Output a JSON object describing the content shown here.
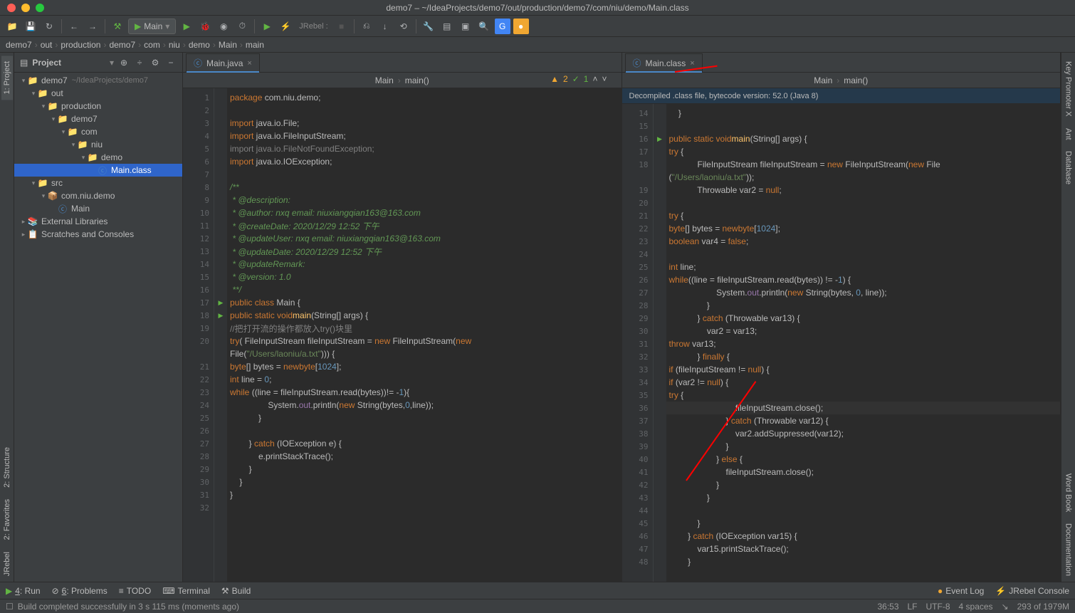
{
  "title": "demo7 – ~/IdeaProjects/demo7/out/production/demo7/com/niu/demo/Main.class",
  "runConfig": "Main",
  "jrebel": "JRebel :",
  "breadcrumb": [
    "demo7",
    "out",
    "production",
    "demo7",
    "com",
    "niu",
    "demo",
    "Main",
    "main"
  ],
  "sidebar": {
    "title": "Project",
    "tree": [
      {
        "l": 0,
        "arrow": "▾",
        "icon": "folder-blue",
        "text": "demo7",
        "path": "~/IdeaProjects/demo7"
      },
      {
        "l": 1,
        "arrow": "▾",
        "icon": "folder",
        "text": "out"
      },
      {
        "l": 2,
        "arrow": "▾",
        "icon": "folder",
        "text": "production"
      },
      {
        "l": 3,
        "arrow": "▾",
        "icon": "folder",
        "text": "demo7"
      },
      {
        "l": 4,
        "arrow": "▾",
        "icon": "folder",
        "text": "com"
      },
      {
        "l": 5,
        "arrow": "▾",
        "icon": "folder",
        "text": "niu"
      },
      {
        "l": 6,
        "arrow": "▾",
        "icon": "folder",
        "text": "demo"
      },
      {
        "l": 7,
        "arrow": "",
        "icon": "class",
        "text": "Main.class",
        "sel": true
      },
      {
        "l": 1,
        "arrow": "▾",
        "icon": "folder-blue",
        "text": "src"
      },
      {
        "l": 2,
        "arrow": "▾",
        "icon": "pkg",
        "text": "com.niu.demo"
      },
      {
        "l": 3,
        "arrow": "",
        "icon": "class",
        "text": "Main"
      },
      {
        "l": 0,
        "arrow": "▸",
        "icon": "lib",
        "text": "External Libraries"
      },
      {
        "l": 0,
        "arrow": "▸",
        "icon": "scratch",
        "text": "Scratches and Consoles"
      }
    ]
  },
  "leftEditor": {
    "tab": "Main.java",
    "bc": [
      "Main",
      "main()"
    ],
    "warn": {
      "y": "2",
      "g": "1"
    },
    "lines": [
      {
        "n": 1,
        "html": "<span class='kw'>package</span> com.niu.demo;"
      },
      {
        "n": 2,
        "html": ""
      },
      {
        "n": 3,
        "html": "<span class='kw'>import</span> java.io.File;"
      },
      {
        "n": 4,
        "html": "<span class='kw'>import</span> java.io.FileInputStream;"
      },
      {
        "n": 5,
        "html": "<span class='cm'>import java.io.FileNotFoundException;</span>"
      },
      {
        "n": 6,
        "html": "<span class='kw'>import</span> java.io.IOException;"
      },
      {
        "n": 7,
        "html": ""
      },
      {
        "n": 8,
        "html": "<span class='cmd'>/**</span>"
      },
      {
        "n": 9,
        "html": "<span class='cmd'> * @description:</span>"
      },
      {
        "n": 10,
        "html": "<span class='cmd'> * @author: nxq email: niuxiangqian163@163.com</span>"
      },
      {
        "n": 11,
        "html": "<span class='cmd'> * @createDate: 2020/12/29 12:52 下午</span>"
      },
      {
        "n": 12,
        "html": "<span class='cmd'> * @updateUser: nxq email: niuxiangqian163@163.com</span>"
      },
      {
        "n": 13,
        "html": "<span class='cmd'> * @updateDate: 2020/12/29 12:52 下午</span>"
      },
      {
        "n": 14,
        "html": "<span class='cmd'> * @updateRemark:</span>"
      },
      {
        "n": 15,
        "html": "<span class='cmd'> * @version: 1.0</span>"
      },
      {
        "n": 16,
        "html": "<span class='cmd'> **/</span>"
      },
      {
        "n": 17,
        "html": "<span class='kw'>public class</span> Main {",
        "mark": "run"
      },
      {
        "n": 18,
        "html": "    <span class='kw'>public static void</span> <span class='fn'>main</span>(String[] args) {",
        "mark": "run"
      },
      {
        "n": 19,
        "html": "        <span class='cm'>//把打开流的操作都放入try()块里</span>"
      },
      {
        "n": 20,
        "html": "        <span class='kw'>try</span>( FileInputStream fileInputStream = <span class='kw'>new</span> FileInputStream(<span class='kw'>new</span> "
      },
      {
        "n": "",
        "html": "File(<span class='str'>\"/Users/laoniu/a.txt\"</span>))) {"
      },
      {
        "n": 21,
        "html": "            <span class='kw'>byte</span>[] bytes = <span class='kw'>new</span> <span class='kw'>byte</span>[<span class='num'>1024</span>];"
      },
      {
        "n": 22,
        "html": "            <span class='kw'>int</span> line = <span class='num'>0</span>;"
      },
      {
        "n": 23,
        "html": "            <span class='kw'>while</span> ((line = fileInputStream.read(bytes))!= -<span class='num'>1</span>){"
      },
      {
        "n": 24,
        "html": "                System.<span style='color:#9876aa'>out</span>.println(<span class='kw'>new</span> String(bytes,<span class='num'>0</span>,line));"
      },
      {
        "n": 25,
        "html": "            }"
      },
      {
        "n": 26,
        "html": ""
      },
      {
        "n": 27,
        "html": "        } <span class='kw'>catch</span> (IOException e) {"
      },
      {
        "n": 28,
        "html": "            e.printStackTrace();"
      },
      {
        "n": 29,
        "html": "        }"
      },
      {
        "n": 30,
        "html": "    }"
      },
      {
        "n": 31,
        "html": "}"
      },
      {
        "n": 32,
        "html": ""
      }
    ]
  },
  "rightEditor": {
    "tab": "Main.class",
    "bc": [
      "Main",
      "main()"
    ],
    "info": "Decompiled .class file, bytecode version: 52.0 (Java 8)",
    "lines": [
      {
        "n": 14,
        "html": "    }"
      },
      {
        "n": 15,
        "html": ""
      },
      {
        "n": 16,
        "html": "    <span class='kw'>public static void</span> <span class='fn'>main</span>(String[] args) {",
        "mark": "run"
      },
      {
        "n": 17,
        "html": "        <span class='kw'>try</span> {"
      },
      {
        "n": 18,
        "html": "            FileInputStream fileInputStream = <span class='kw'>new</span> FileInputStream(<span class='kw'>new</span> File"
      },
      {
        "n": "",
        "html": "(<span class='str'>\"/Users/laoniu/a.txt\"</span>));"
      },
      {
        "n": 19,
        "html": "            Throwable var2 = <span class='kw'>null</span>;"
      },
      {
        "n": 20,
        "html": ""
      },
      {
        "n": 21,
        "html": "            <span class='kw'>try</span> {"
      },
      {
        "n": 22,
        "html": "                <span class='kw'>byte</span>[] bytes = <span class='kw'>new</span> <span class='kw'>byte</span>[<span class='num'>1024</span>];"
      },
      {
        "n": 23,
        "html": "                <span class='kw'>boolean</span> var4 = <span class='kw'>false</span>;"
      },
      {
        "n": 24,
        "html": ""
      },
      {
        "n": 25,
        "html": "                <span class='kw'>int</span> line;"
      },
      {
        "n": 26,
        "html": "                <span class='kw'>while</span>((line = fileInputStream.read(bytes)) != -<span class='num'>1</span>) {"
      },
      {
        "n": 27,
        "html": "                    System.<span style='color:#9876aa'>out</span>.println(<span class='kw'>new</span> String(bytes, <span class='num'>0</span>, line));"
      },
      {
        "n": 28,
        "html": "                }"
      },
      {
        "n": 29,
        "html": "            } <span class='kw'>catch</span> (Throwable var13) {"
      },
      {
        "n": 30,
        "html": "                var2 = var13;"
      },
      {
        "n": 31,
        "html": "                <span class='kw'>throw</span> var13;"
      },
      {
        "n": 32,
        "html": "            } <span class='kw'>finally</span> {"
      },
      {
        "n": 33,
        "html": "                <span class='kw'>if</span> (fileInputStream != <span class='kw'>null</span>) {"
      },
      {
        "n": 34,
        "html": "                    <span class='kw'>if</span> (var2 != <span class='kw'>null</span>) {"
      },
      {
        "n": 35,
        "html": "                        <span class='kw'>try</span> {"
      },
      {
        "n": 36,
        "html": "                            fileInputStream.close();",
        "hl": true
      },
      {
        "n": 37,
        "html": "                        } <span class='kw'>catch</span> (Throwable var12) {"
      },
      {
        "n": 38,
        "html": "                            var2.addSuppressed(var12);"
      },
      {
        "n": 39,
        "html": "                        }"
      },
      {
        "n": 40,
        "html": "                    } <span class='kw'>else</span> {"
      },
      {
        "n": 41,
        "html": "                        fileInputStream.close();"
      },
      {
        "n": 42,
        "html": "                    }"
      },
      {
        "n": 43,
        "html": "                }"
      },
      {
        "n": 44,
        "html": ""
      },
      {
        "n": 45,
        "html": "            }"
      },
      {
        "n": 46,
        "html": "        } <span class='kw'>catch</span> (IOException var15) {"
      },
      {
        "n": 47,
        "html": "            var15.printStackTrace();"
      },
      {
        "n": 48,
        "html": "        }"
      }
    ]
  },
  "leftGutter": [
    "1: Project"
  ],
  "rightGutter": [
    "Key Promoter X",
    "Ant",
    "Database",
    "Word Book",
    "Documentation"
  ],
  "bottom": [
    "4: Run",
    "6: Problems",
    "TODO",
    "Terminal",
    "Build"
  ],
  "bottomRight": [
    "Event Log",
    "JRebel Console"
  ],
  "status": {
    "msg": "Build completed successfully in 3 s 115 ms (moments ago)",
    "pos": "36:53",
    "lf": "LF",
    "enc": "UTF-8",
    "indent": "4 spaces",
    "mem": "293 of 1979M"
  },
  "leftGutterExtra": [
    "2: Structure",
    "2: Favorites",
    "JRebel"
  ]
}
